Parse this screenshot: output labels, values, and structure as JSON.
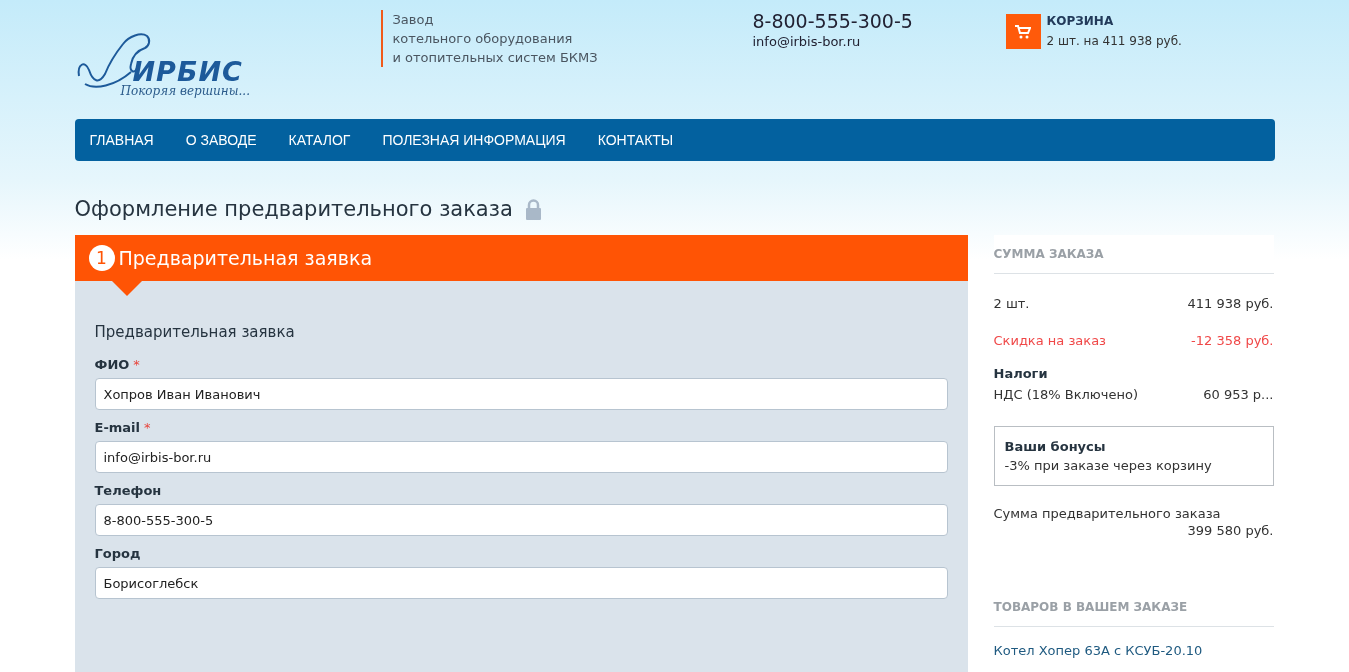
{
  "header": {
    "logo": {
      "name": "ИРБИС",
      "slogan": "Покоряя вершины..."
    },
    "tagline": [
      "Завод",
      "котельного оборудования",
      "и отопительных систем БКМЗ"
    ],
    "phone": "8-800-555-300-5",
    "email": "info@irbis-bor.ru",
    "cart": {
      "title": "КОРЗИНА",
      "summary": "2 шт. на 411 938 руб."
    }
  },
  "nav": [
    "ГЛАВНАЯ",
    "О ЗАВОДЕ",
    "КАТАЛОГ",
    "ПОЛЕЗНАЯ ИНФОРМАЦИЯ",
    "КОНТАКТЫ"
  ],
  "page_title": "Оформление предварительного заказа",
  "step": {
    "number": "1",
    "title": "Предварительная заявка"
  },
  "form": {
    "section_title": "Предварительная заявка",
    "fields": [
      {
        "label": "ФИО",
        "required_mark": "*",
        "value": "Хопров Иван Иванович"
      },
      {
        "label": "E-mail",
        "required_mark": "*",
        "value": "info@irbis-bor.ru"
      },
      {
        "label": "Телефон",
        "value": "8-800-555-300-5"
      },
      {
        "label": "Город",
        "value": "Борисоглебск"
      }
    ]
  },
  "summary": {
    "title": "СУММА ЗАКАЗА",
    "rows": [
      {
        "kind": "line",
        "label": "2 шт.",
        "value": "411 938 руб."
      },
      {
        "kind": "discount",
        "label": "Скидка на заказ",
        "value": "-12 358 руб."
      }
    ],
    "taxes_title": "Налоги",
    "tax": {
      "label": "НДС (18% Включено)",
      "value": "60 953 р..."
    },
    "bonus": {
      "title": "Ваши бонусы",
      "text": "-3% при заказе через корзину"
    },
    "total": {
      "label": "Сумма предварительного заказа",
      "value": "399 580 руб."
    }
  },
  "items": {
    "title": "ТОВАРОВ В ВАШЕМ ЗАКАЗЕ",
    "list": [
      "Котел Хопер 63А с КСУБ-20.10"
    ]
  }
}
